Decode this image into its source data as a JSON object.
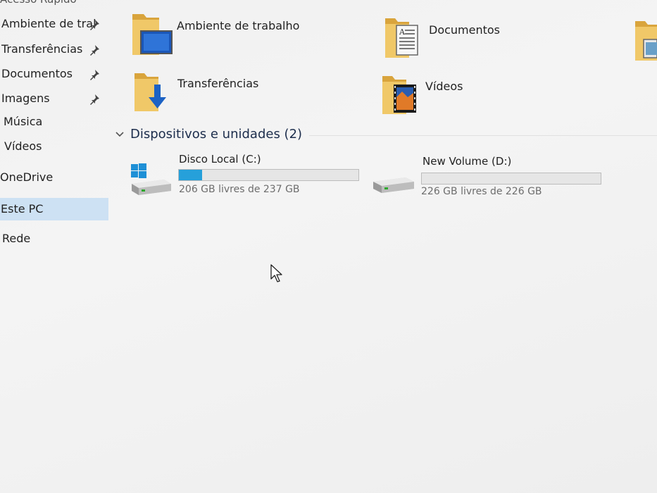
{
  "sidebar": {
    "header": "Acesso Rápido",
    "items": [
      {
        "label": "Ambiente de tral",
        "pinned": true,
        "icon": "pin-icon"
      },
      {
        "label": "Transferências",
        "pinned": true,
        "icon": "pin-icon"
      },
      {
        "label": "Documentos",
        "pinned": true,
        "icon": "pin-icon"
      },
      {
        "label": "Imagens",
        "pinned": true,
        "icon": "pin-icon"
      },
      {
        "label": "Música",
        "pinned": false
      },
      {
        "label": "Vídeos",
        "pinned": false
      },
      {
        "label": "OneDrive",
        "pinned": false
      },
      {
        "label": "Este PC",
        "pinned": false,
        "selected": true
      },
      {
        "label": "Rede",
        "pinned": false
      }
    ]
  },
  "folders": [
    {
      "label": "Ambiente de trabalho",
      "icon": "desktop-folder-icon"
    },
    {
      "label": "Documentos",
      "icon": "documents-folder-icon"
    },
    {
      "label": "Transferências",
      "icon": "downloads-folder-icon"
    },
    {
      "label": "Vídeos",
      "icon": "videos-folder-icon"
    }
  ],
  "devices": {
    "title": "Dispositivos e unidades (2)",
    "drives": [
      {
        "name": "Disco Local (C:)",
        "free_text": "206 GB livres de 237 GB",
        "used_fraction": 0.131,
        "icon": "windows-drive-icon"
      },
      {
        "name": "New Volume (D:)",
        "free_text": "226 GB livres de 226 GB",
        "used_fraction": 0.0,
        "icon": "hard-drive-icon"
      }
    ]
  },
  "colors": {
    "selection": "#cde1f3",
    "usage_bar": "#26a0da",
    "folder_yellow": "#e9c46a",
    "windows_blue": "#1e90d6"
  }
}
